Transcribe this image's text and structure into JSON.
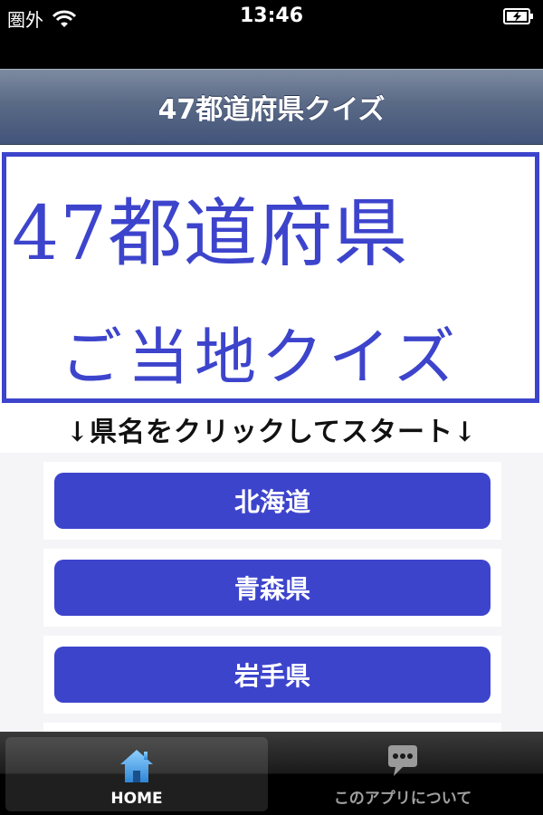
{
  "status_bar": {
    "carrier": "圏外",
    "time": "13:46"
  },
  "nav": {
    "title": "47都道府県クイズ"
  },
  "banner": {
    "line1": "47都道府県",
    "line2": "ご当地クイズ",
    "color": "#3d44cc"
  },
  "instruction": "↓県名をクリックしてスタート↓",
  "prefectures": [
    "北海道",
    "青森県",
    "岩手県"
  ],
  "tabs": [
    {
      "label": "HOME",
      "icon": "home-icon",
      "selected": true
    },
    {
      "label": "このアプリについて",
      "icon": "speech-bubble-icon",
      "selected": false
    }
  ],
  "colors": {
    "accent": "#3d44cc",
    "nav_bar": "#5a6a86"
  }
}
